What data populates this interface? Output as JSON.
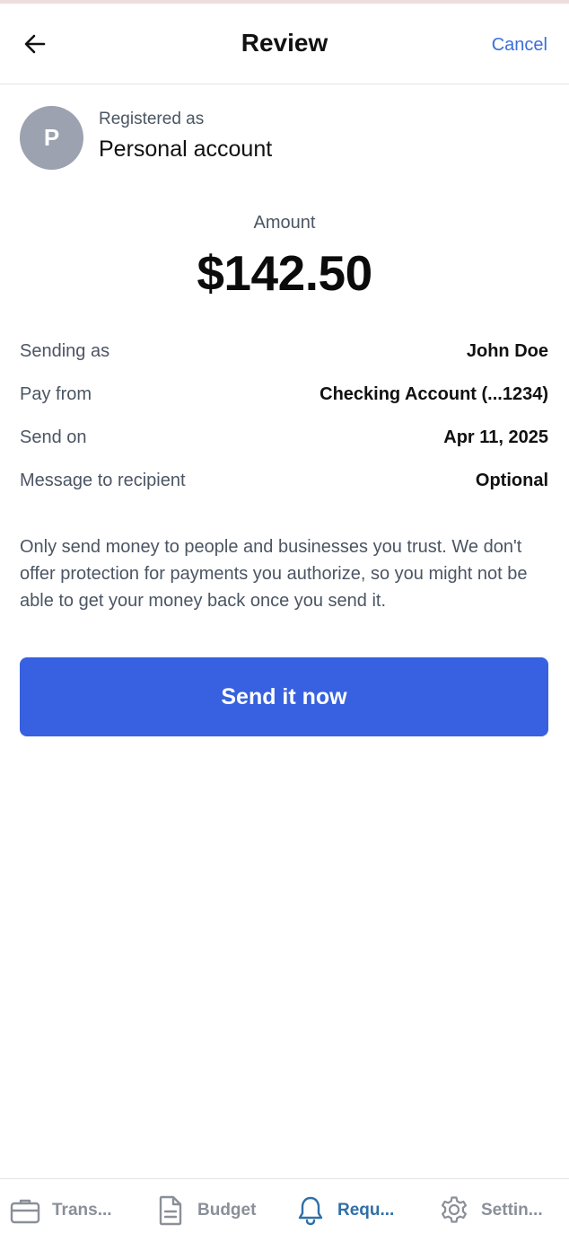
{
  "header": {
    "title": "Review",
    "cancel_label": "Cancel",
    "back_icon": "arrow-left-icon"
  },
  "account": {
    "avatar_initial": "P",
    "registered_label": "Registered as",
    "type": "Personal account"
  },
  "amount": {
    "label": "Amount",
    "value": "$142.50"
  },
  "details": [
    {
      "label": "Sending as",
      "value": "John Doe"
    },
    {
      "label": "Pay from",
      "value": "Checking Account (...1234)"
    },
    {
      "label": "Send on",
      "value": "Apr 11, 2025"
    },
    {
      "label": "Message to recipient",
      "value": "Optional"
    }
  ],
  "warning_text": "Only send money to people and businesses you trust. We don't offer protection for payments you authorize, so you might not be able to get your money back once you send it.",
  "send_button_label": "Send it now",
  "colors": {
    "accent": "#3761e0",
    "link": "#3b6fd8",
    "active_nav": "#2f6fa8",
    "inactive_nav": "#8a8f98",
    "avatar_bg": "#9ca2af"
  },
  "bottom_nav": [
    {
      "label": "Trans...",
      "icon": "briefcase-icon",
      "active": false
    },
    {
      "label": "Budget",
      "icon": "document-icon",
      "active": false
    },
    {
      "label": "Requ...",
      "icon": "bell-icon",
      "active": true
    },
    {
      "label": "Settin...",
      "icon": "gear-icon",
      "active": false
    }
  ]
}
